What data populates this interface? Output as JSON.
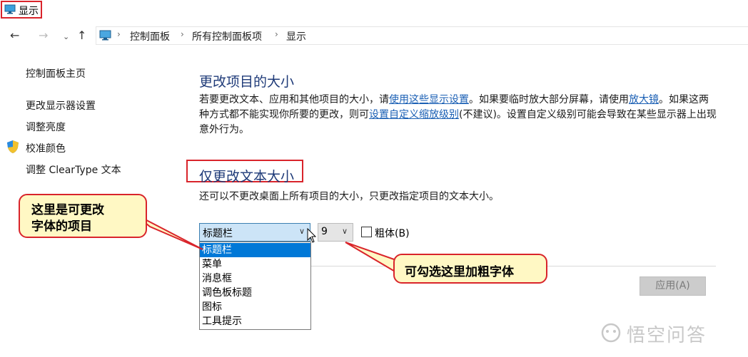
{
  "window": {
    "title": "显示"
  },
  "nav": {
    "back_icon": "←",
    "forward_icon": "→",
    "recent_icon": "⌄",
    "up_icon": "↑",
    "separator": "›",
    "breadcrumbs": [
      "控制面板",
      "所有控制面板项",
      "显示"
    ]
  },
  "sidebar": {
    "home": "控制面板主页",
    "items": [
      "更改显示器设置",
      "调整亮度",
      "校准颜色",
      "调整 ClearType 文本"
    ]
  },
  "main": {
    "section1": {
      "title": "更改项目的大小",
      "para": {
        "p1": "若要更改文本、应用和其他项目的大小，请",
        "link1": "使用这些显示设置",
        "p2": "。如果要临时放大部分屏幕，请使用",
        "link2": "放大镜",
        "p3": "。如果这两种方式都不能实现你所要的更改，则可",
        "link3": "设置自定义缩放级别",
        "p4": "(不建议)。设置自定义级别可能会导致在某些显示器上出现意外行为。"
      }
    },
    "section2": {
      "title": "仅更改文本大小",
      "desc": "还可以不更改桌面上所有项目的大小，只更改指定项目的文本大小。"
    },
    "item_select": {
      "value": "标题栏",
      "arrow": "∨"
    },
    "size_select": {
      "value": "9",
      "arrow": "∨"
    },
    "bold_label": "粗体(B)",
    "dropdown_options": [
      "标题栏",
      "菜单",
      "消息框",
      "调色板标题",
      "图标",
      "工具提示"
    ],
    "apply_label": "应用(A)"
  },
  "annotations": {
    "callout_left": [
      "这里是可更改",
      "字体的项目"
    ],
    "callout_right": "可勾选这里加粗字体"
  },
  "watermark": "悟空问答",
  "colors": {
    "accent": "#0078d7",
    "link": "#1a5fb4",
    "heading": "#1e3a78",
    "highlight_box": "#d9242b",
    "callout_fill": "#fff8c4"
  }
}
